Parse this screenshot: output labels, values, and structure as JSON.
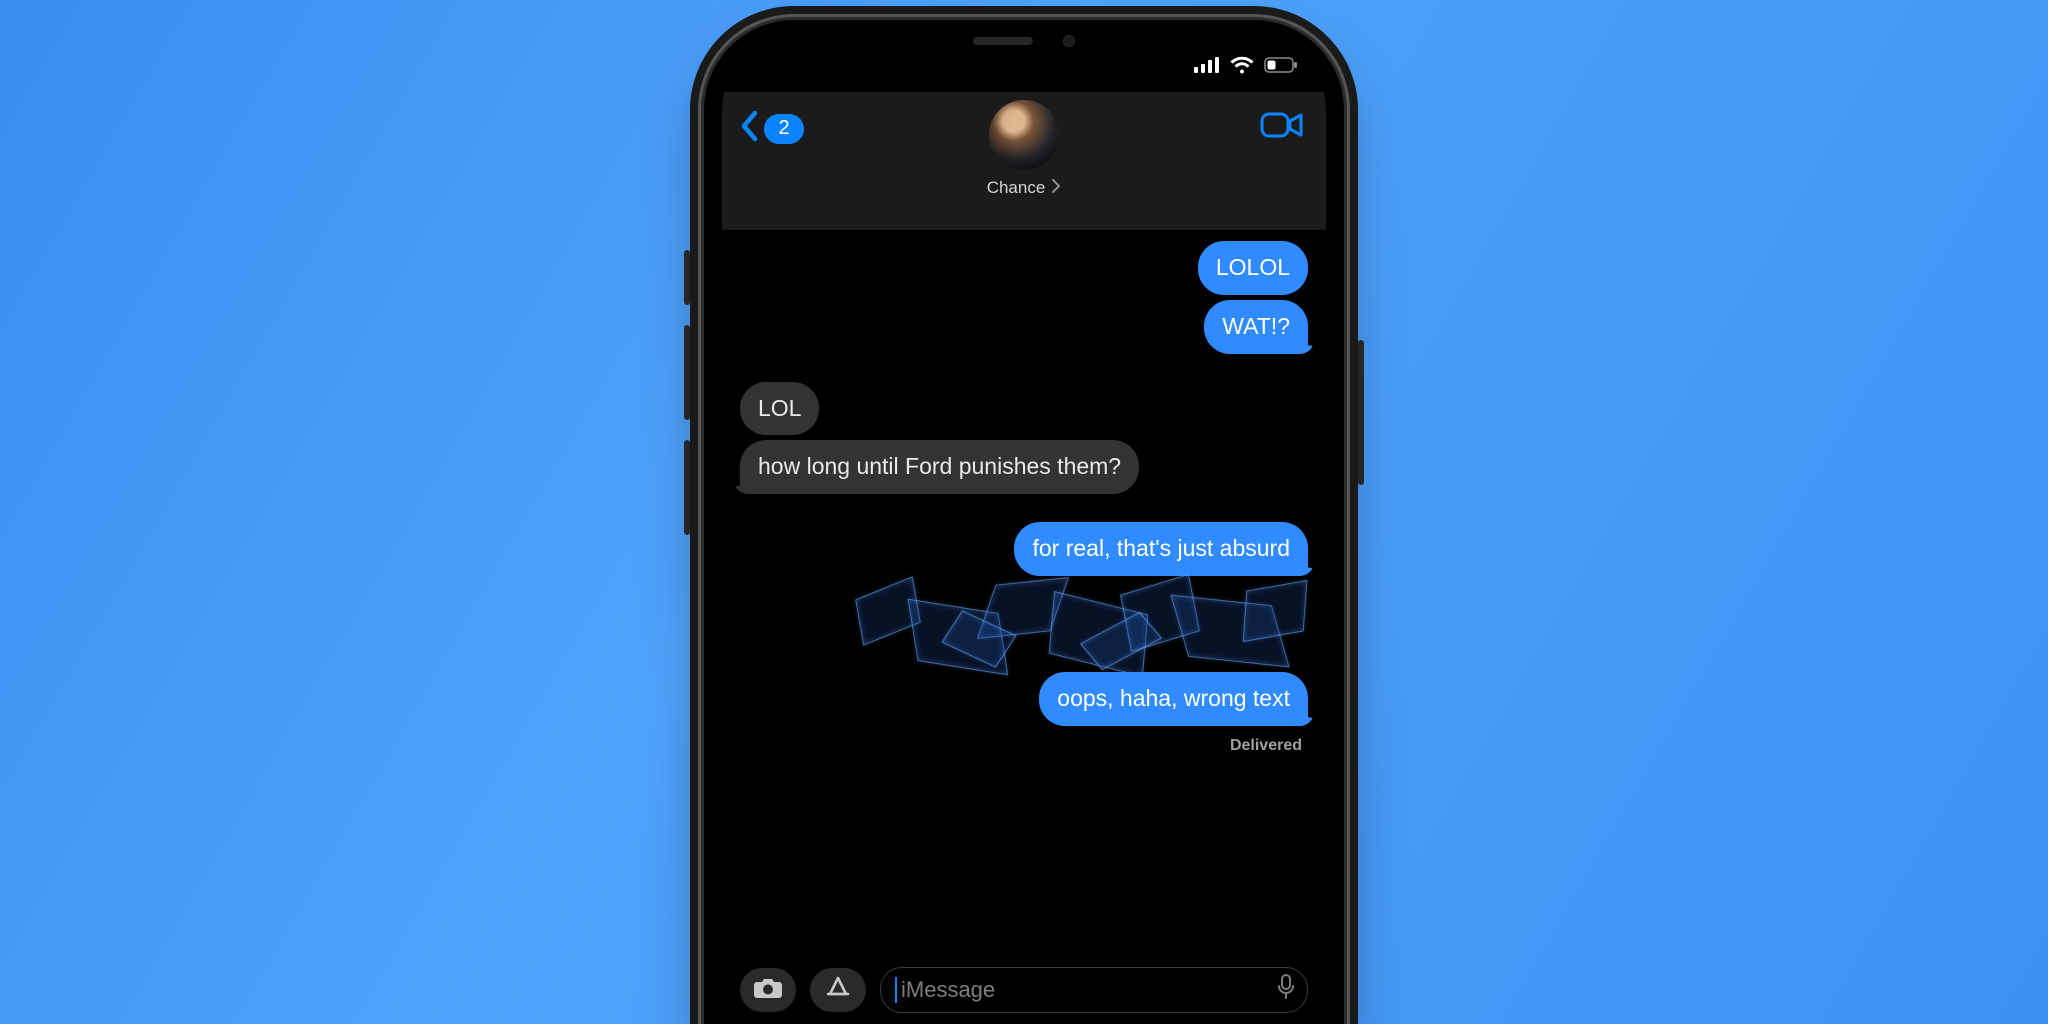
{
  "accent": "#0b84ff",
  "header": {
    "back_badge": "2",
    "contact_name": "Chance"
  },
  "messages": [
    {
      "side": "sent",
      "text": "LOLOL",
      "stack": true
    },
    {
      "side": "sent",
      "text": "WAT!?",
      "stack": false
    },
    {
      "side": "recv",
      "text": "LOL",
      "stack": true
    },
    {
      "side": "recv",
      "text": "how long until Ford punishes them?",
      "stack": false
    },
    {
      "side": "sent",
      "text": "for real, that's just absurd",
      "stack": false
    },
    {
      "side": "sent",
      "text": "oops, haha, wrong text",
      "stack": false
    }
  ],
  "delivered_label": "Delivered",
  "input": {
    "placeholder": "iMessage"
  },
  "status": {
    "cell_bars": 4,
    "wifi_bars": 3,
    "battery_pct": 30
  }
}
